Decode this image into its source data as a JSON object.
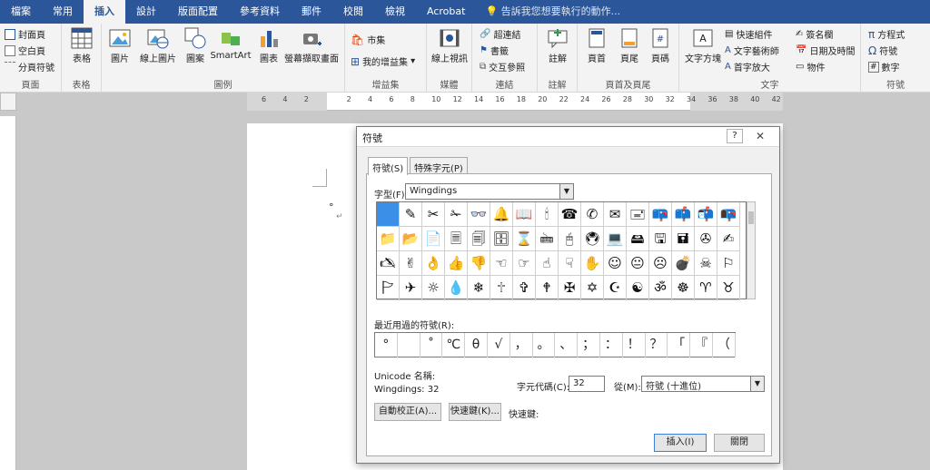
{
  "menu": {
    "tabs": [
      "檔案",
      "常用",
      "插入",
      "設計",
      "版面配置",
      "參考資料",
      "郵件",
      "校閱",
      "檢視",
      "Acrobat"
    ],
    "active_index": 2,
    "tell_me": "告訴我您想要執行的動作..."
  },
  "ribbon": {
    "pages": {
      "cover": "封面頁",
      "blank": "空白頁",
      "break": "分頁符號",
      "label": "頁面"
    },
    "tables": {
      "table": "表格",
      "label": "表格"
    },
    "illustrations": {
      "picture": "圖片",
      "online_picture": "線上圖片",
      "shapes": "圖案",
      "smartart": "SmartArt",
      "chart": "圖表",
      "screenshot": "螢幕擷取畫面",
      "label": "圖例"
    },
    "addins": {
      "store": "市集",
      "my_addins": "我的增益集",
      "label": "增益集"
    },
    "media": {
      "online_video": "線上視訊",
      "label": "媒體"
    },
    "links": {
      "hyperlink": "超連結",
      "bookmark": "書籤",
      "cross_ref": "交互參照",
      "label": "連結"
    },
    "comments": {
      "comment": "註解",
      "label": "註解"
    },
    "header_footer": {
      "header": "頁首",
      "footer": "頁尾",
      "page_number": "頁碼",
      "label": "頁首及頁尾"
    },
    "text": {
      "textbox": "文字方塊",
      "quick_parts": "快速組件",
      "wordart": "文字藝術師",
      "dropcap": "首字放大",
      "signature": "簽名欄",
      "datetime": "日期及時間",
      "object": "物件",
      "label": "文字"
    },
    "symbols": {
      "equation": "方程式",
      "symbol": "符號",
      "number": "數字",
      "label": "符號"
    }
  },
  "ruler": {
    "numbers": [
      "6",
      "4",
      "2",
      "",
      "2",
      "4",
      "6",
      "8",
      "10",
      "12",
      "14",
      "16",
      "18",
      "20",
      "22",
      "24",
      "26",
      "28",
      "30",
      "32",
      "34",
      "36",
      "38",
      "40",
      "42"
    ]
  },
  "dialog": {
    "title": "符號",
    "help": "?",
    "tab_symbols": "符號(S)",
    "tab_special": "特殊字元(P)",
    "font_label": "字型(F):",
    "font_value": "Wingdings",
    "symbols": [
      "",
      "✎",
      "✂",
      "✁",
      "👓",
      "🔔",
      "📖",
      "🕯",
      "☎",
      "✆",
      "✉",
      "🖃",
      "📪",
      "📫",
      "📬",
      "📭",
      "📁",
      "📂",
      "📄",
      "🗏",
      "🗐",
      "🗄",
      "⌛",
      "🖮",
      "🖰",
      "🖲",
      "💻",
      "🖴",
      "🖫",
      "🖬",
      "✇",
      "✍",
      "🖎",
      "✌",
      "👌",
      "👍",
      "👎",
      "☜",
      "☞",
      "☝",
      "☟",
      "✋",
      "☺",
      "😐",
      "☹",
      "💣",
      "☠",
      "⚐",
      "🏱",
      "✈",
      "☼",
      "💧",
      "❄",
      "🕆",
      "✞",
      "🕈",
      "✠",
      "✡",
      "☪",
      "☯",
      "ॐ",
      "☸",
      "♈",
      "♉"
    ],
    "recent_label": "最近用過的符號(R):",
    "recent": [
      "°",
      "",
      "˚",
      "℃",
      "θ",
      "√",
      "，",
      "。",
      "、",
      "；",
      "：",
      "！",
      "？",
      "「",
      "『",
      "（"
    ],
    "unicode_name_label": "Unicode 名稱:",
    "unicode_name_value": "Wingdings: 32",
    "charcode_label": "字元代碼(C):",
    "charcode_value": "32",
    "from_label": "從(M):",
    "from_value": "符號 (十進位)",
    "autocorrect": "自動校正(A)...",
    "shortcut_key": "快速鍵(K)...",
    "shortcut_label": "快速鍵:",
    "insert": "插入(I)",
    "close": "關閉"
  }
}
